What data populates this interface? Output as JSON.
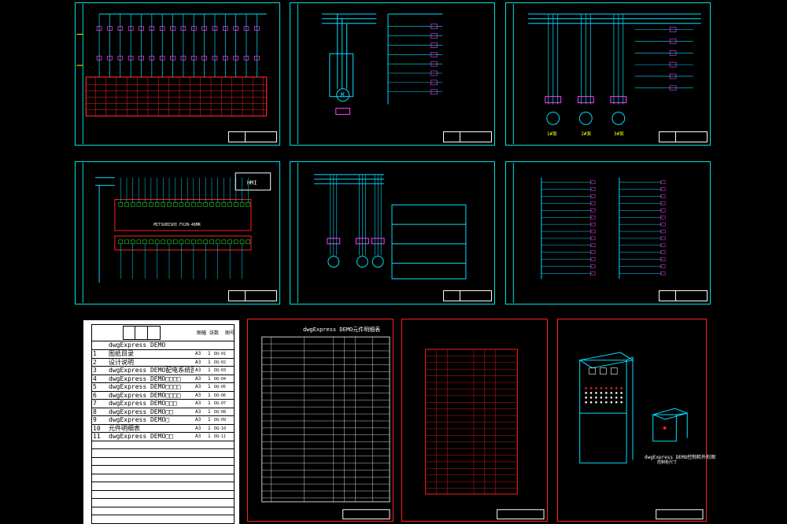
{
  "workbook": {
    "header": {
      "title": "dwgExpress DEMO",
      "col_size": "图幅",
      "col_count": "张数",
      "col_code": "图号"
    },
    "rows": [
      {
        "no": "1",
        "name": "图纸目录",
        "size": "A3",
        "count": "1",
        "code": "DQ-01"
      },
      {
        "no": "2",
        "name": "设计说明",
        "size": "A3",
        "count": "1",
        "code": "DQ-02"
      },
      {
        "no": "3",
        "name": "dwgExpress DEMO配电系统图",
        "size": "A3",
        "count": "1",
        "code": "DQ-03"
      },
      {
        "no": "4",
        "name": "dwgExpress DEMO□□□□",
        "size": "A3",
        "count": "1",
        "code": "DQ-04"
      },
      {
        "no": "5",
        "name": "dwgExpress DEMO□□□□",
        "size": "A3",
        "count": "1",
        "code": "DQ-05"
      },
      {
        "no": "6",
        "name": "dwgExpress DEMO□□□□",
        "size": "A3",
        "count": "1",
        "code": "DQ-06"
      },
      {
        "no": "7",
        "name": "dwgExpress DEMO□□□",
        "size": "A3",
        "count": "1",
        "code": "DQ-07"
      },
      {
        "no": "8",
        "name": "dwgExpress DEMO□□",
        "size": "A3",
        "count": "1",
        "code": "DQ-08"
      },
      {
        "no": "9",
        "name": "dwgExpress DEMO□",
        "size": "A3",
        "count": "1",
        "code": "DQ-09"
      },
      {
        "no": "10",
        "name": "元件明细表",
        "size": "A3",
        "count": "1",
        "code": "DQ-10"
      },
      {
        "no": "11",
        "name": "dwgExpress DEMO□□",
        "size": "A3",
        "count": "1",
        "code": "DQ-11"
      }
    ]
  },
  "sheets": {
    "plc": {
      "box_label": "HMI",
      "device_label": "MITSUBISHI  FX2N-48MR"
    },
    "parts_list": {
      "title": "dwgExpress DEMO元件明细表"
    },
    "cabinet": {
      "caption": "dwgExpress DEMO控制柜外形图",
      "sub": "控制柜尺寸"
    },
    "motors": {
      "m1": "1#泵",
      "m2": "2#泵",
      "m3": "3#泵"
    }
  },
  "colors": {
    "frame": "#00e0e0",
    "wire": "#00e0ff",
    "red": "#ff2020",
    "magenta": "#ff40ff",
    "green": "#30ff30"
  }
}
